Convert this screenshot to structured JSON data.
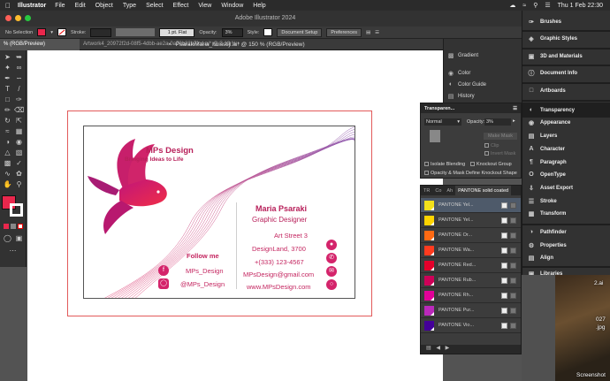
{
  "menubar": {
    "app": "Illustrator",
    "items": [
      "File",
      "Edit",
      "Object",
      "Type",
      "Select",
      "Effect",
      "View",
      "Window",
      "Help"
    ],
    "datetime": "Thu 1 Feb 22:30"
  },
  "window": {
    "title": "Adobe Illustrator 2024"
  },
  "controlbar": {
    "selection": "No Selection",
    "stroke_label": "Stroke:",
    "brush": "1 pt. Flat",
    "opacity_label": "Opacity:",
    "opacity": "3%",
    "style_label": "Style:",
    "document_setup": "Document Setup",
    "preferences": "Preferences",
    "fill_color": "#e8274c"
  },
  "tabs": {
    "active_partial": "% (RGB/Preview)",
    "second": "Artwork4_20972f2d-08f5-4dbb-ae2a-0a79b82b7fcd.ai* @ 3.13 % (RGB/Preview)",
    "document": "PsarakiMaria_huisstijl.ai* @ 150 % (RGB/Preview)"
  },
  "card": {
    "brand": "MPs Design",
    "tagline": "Bringing Ideas to Life",
    "name": "Maria Psaraki",
    "role": "Graphic Designer",
    "street": "Art Street 3",
    "city": "DesignLand, 3700",
    "phone": "+(333) 123-4567",
    "email": "MPsDesign@gmail.com",
    "website": "www.MPsDesign.com",
    "follow": "Follow me",
    "facebook": "MPs_Design",
    "instagram": "@MPs_Design",
    "accent": "#d4246b"
  },
  "midpanel": {
    "items": [
      "Gradient",
      "Color",
      "Color Guide",
      "History"
    ]
  },
  "transparency": {
    "title": "Transparen...",
    "mode": "Normal",
    "opacity_label": "Opacity:",
    "opacity": "3%",
    "make_mask": "Make Mask",
    "clip": "Clip",
    "invert_mask": "Invert Mask",
    "isolate": "Isolate Blending",
    "knockout": "Knockout Group",
    "opacity_mask": "Opacity & Mask Define Knockout Shape"
  },
  "swatches": {
    "tabs": [
      "TR",
      "Co",
      "Ah",
      "PANTONE solid coated"
    ],
    "rows": [
      {
        "name": "PANTONE Yel...",
        "color": "#f2e01b"
      },
      {
        "name": "PANTONE Yel...",
        "color": "#ffd400"
      },
      {
        "name": "PANTONE Or...",
        "color": "#ff6a13"
      },
      {
        "name": "PANTONE Wa...",
        "color": "#ff3b1f"
      },
      {
        "name": "PANTONE Red...",
        "color": "#e4002b"
      },
      {
        "name": "PANTONE Rub...",
        "color": "#ce0058"
      },
      {
        "name": "PANTONE Rh...",
        "color": "#e10098"
      },
      {
        "name": "PANTONE Pur...",
        "color": "#bb29bb"
      },
      {
        "name": "PANTONE Vio...",
        "color": "#440099"
      }
    ]
  },
  "rightdock": {
    "items": [
      "Brushes",
      "Graphic Styles",
      "3D and Materials",
      "Document Info",
      "Artboards",
      "Transparency",
      "Appearance",
      "Layers",
      "Character",
      "Paragraph",
      "OpenType",
      "Asset Export",
      "Stroke",
      "Transform",
      "Pathfinder",
      "Properties",
      "Align",
      "Libraries"
    ]
  },
  "desktop": {
    "file1": "2.ai",
    "file2": "027",
    "file3": ".jpg",
    "file4": "Screenshot"
  }
}
